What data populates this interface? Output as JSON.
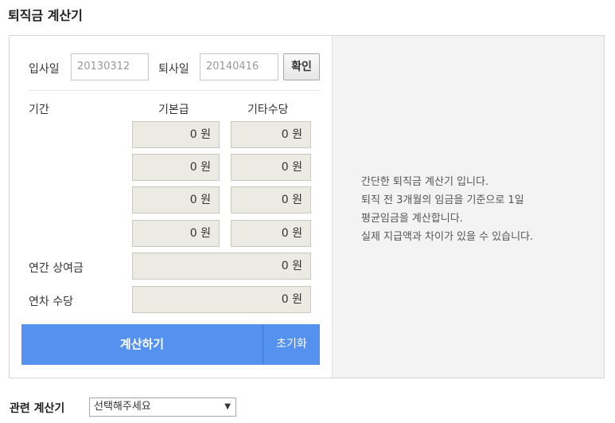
{
  "page": {
    "title": "퇴직금 계산기"
  },
  "dates": {
    "hire_label": "입사일",
    "hire_value": "20130312",
    "leave_label": "퇴사일",
    "leave_value": "20140416",
    "confirm_label": "확인"
  },
  "table": {
    "period_header": "기간",
    "base_header": "기본급",
    "other_header": "기타수당",
    "rows": [
      {
        "base": "0 원",
        "other": "0 원"
      },
      {
        "base": "0 원",
        "other": "0 원"
      },
      {
        "base": "0 원",
        "other": "0 원"
      },
      {
        "base": "0 원",
        "other": "0 원"
      }
    ]
  },
  "bonus": {
    "label": "연간 상여금",
    "value": "0 원"
  },
  "annual_leave": {
    "label": "연차 수당",
    "value": "0 원"
  },
  "actions": {
    "calculate_label": "계산하기",
    "reset_label": "초기화"
  },
  "info": {
    "lines": [
      "간단한 퇴직금 계산기 입니다.",
      "퇴직 전 3개월의 임금을 기준으로 1일",
      "평균임금을 계산합니다.",
      "실제 지급액과 차이가 있을 수 있습니다."
    ]
  },
  "related": {
    "label": "관련 계산기",
    "selected": "선택해주세요",
    "arrow_icon": "triangle-down-icon"
  }
}
